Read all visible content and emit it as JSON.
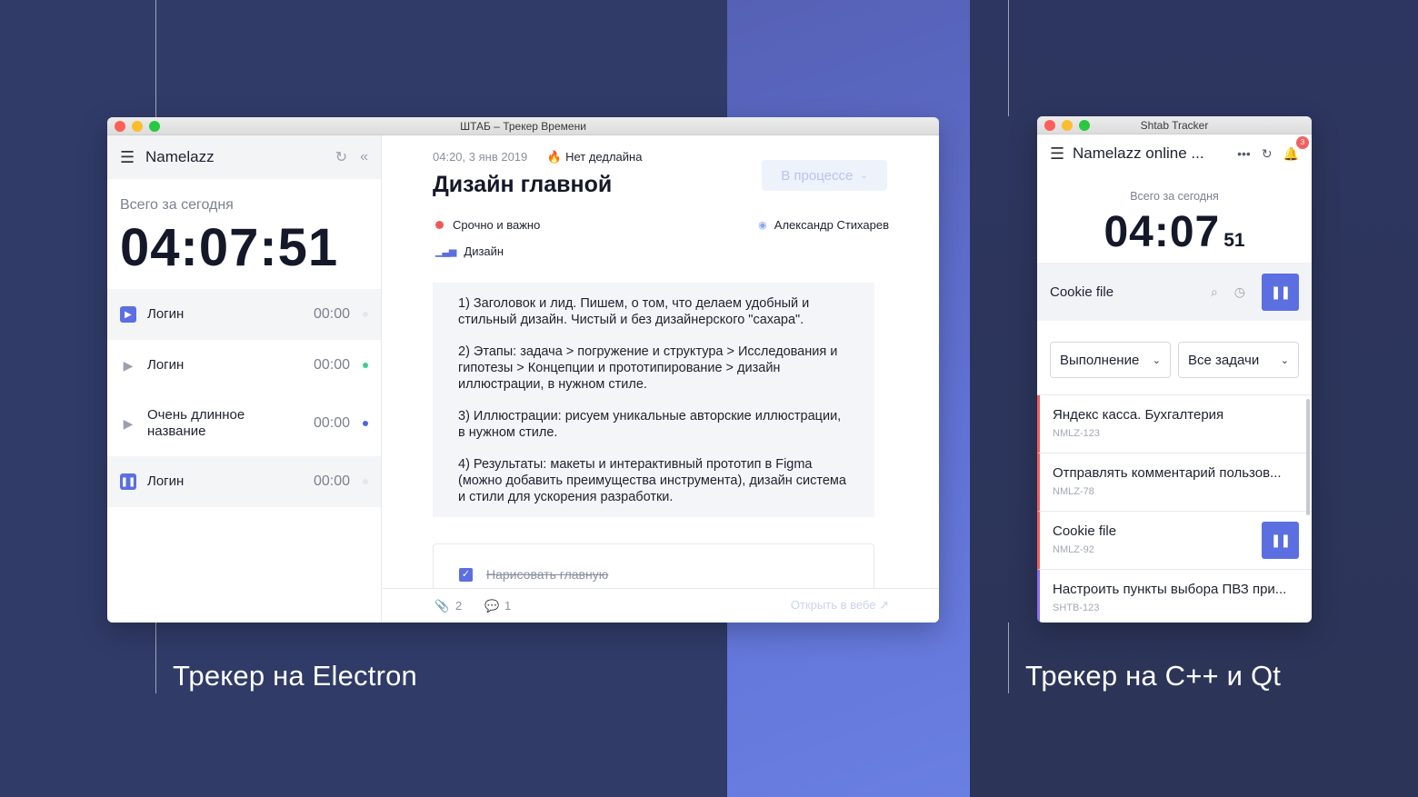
{
  "captions": {
    "left": "Трекер на Electron",
    "right": "Трекер на C++ и Qt"
  },
  "electron": {
    "window_title": "ШТАБ – Трекер Времени",
    "sidebar": {
      "workspace": "Namelazz",
      "total_label": "Всего за сегодня",
      "total_time": "04:07:51",
      "items": [
        {
          "label": "Логин",
          "time": "00:00",
          "state": "play-active",
          "dot_color": "#e4e6ec"
        },
        {
          "label": "Логин",
          "time": "00:00",
          "state": "idle",
          "dot_color": "#3fcf8e"
        },
        {
          "label": "Очень длинное название",
          "time": "00:00",
          "state": "idle",
          "dot_color": "#4a66e0"
        },
        {
          "label": "Логин",
          "time": "00:00",
          "state": "paused",
          "dot_color": "#e4e6ec"
        }
      ]
    },
    "task": {
      "datetime": "04:20, 3 янв 2019",
      "deadline": "Нет дедлайна",
      "title": "Дизайн главной",
      "status": "В процессе",
      "priority": "Срочно и важно",
      "category": "Дизайн",
      "assignee": "Александр Стихарев",
      "description": [
        "1) Заголовок и лид. Пишем, о том, что делаем удобный и стильный дизайн. Чистый и без дизайнерского \"сахара\".",
        "2) Этапы: задача > погружение и структура > Исследования и гипотезы > Концепции и прототипирование > дизайн иллюстрации, в нужном стиле.",
        "3) Иллюстрации: рисуем уникальные авторские иллюстрации, в нужном стиле.",
        "4) Результаты: макеты и интерактивный прототип в Figma (можно добавить преимущества инструмента), дизайн система и стили для ускорения разработки."
      ],
      "checklist_item": "Нарисовать главную",
      "attachments_count": "2",
      "comments_count": "1",
      "open_web": "Открыть в вебе"
    }
  },
  "qt": {
    "window_title": "Shtab Tracker",
    "workspace": "Namelazz online ...",
    "notifications_badge": "3",
    "total_label": "Всего за сегодня",
    "total_time_main": "04:07",
    "total_time_seconds": "51",
    "current_task": "Cookie file",
    "filter_status": "Выполнение",
    "filter_tasks": "Все задачи",
    "tasks": [
      {
        "title": "Яндекс касса. Бухгалтерия",
        "key": "NMLZ-123",
        "color": "#f06262",
        "running": false
      },
      {
        "title": "Отправлять комментарий пользов...",
        "key": "NMLZ-78",
        "color": "#f06262",
        "running": false
      },
      {
        "title": "Cookie file",
        "key": "NMLZ-92",
        "color": "#f06262",
        "running": true
      },
      {
        "title": "Настроить пункты выбора ПВЗ при...",
        "key": "SHTB-123",
        "color": "#8d6fe6",
        "running": false
      }
    ]
  }
}
